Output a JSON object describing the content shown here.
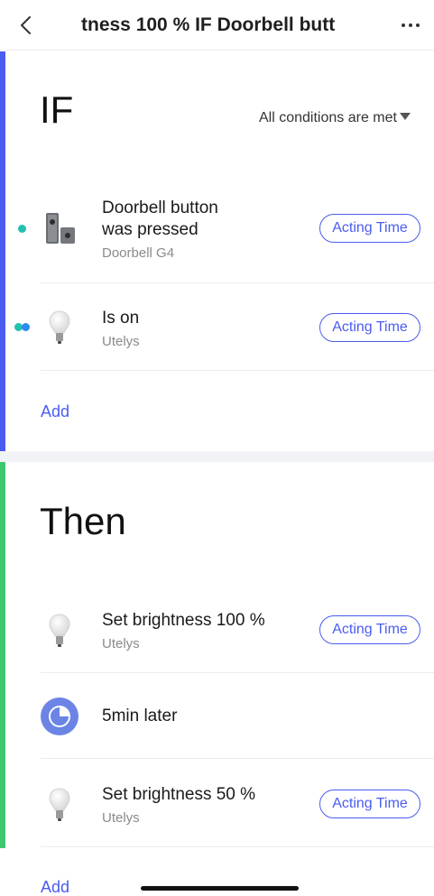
{
  "nav": {
    "title": "tness 100 %    IF Doorbell butt",
    "back_icon": "chevron-left-icon",
    "more_icon": "more-dots-icon"
  },
  "if_section": {
    "heading": "IF",
    "condition_mode": "All conditions are met",
    "items": [
      {
        "title_line1": "Doorbell button",
        "title_line2": "was pressed",
        "device": "Doorbell G4",
        "action": "Acting Time",
        "icon": "doorbell-icon"
      },
      {
        "title_line1": "Is on",
        "device": "Utelys",
        "action": "Acting Time",
        "icon": "bulb-icon"
      }
    ],
    "add_label": "Add"
  },
  "then_section": {
    "heading": "Then",
    "items": [
      {
        "title": "Set brightness 100 %",
        "device": "Utelys",
        "action": "Acting Time",
        "icon": "bulb-icon"
      },
      {
        "title": "5min later",
        "icon": "clock-icon"
      },
      {
        "title": "Set brightness 50 %",
        "device": "Utelys",
        "action": "Acting Time",
        "icon": "bulb-icon"
      }
    ],
    "add_label": "Add"
  },
  "colors": {
    "accent": "#4b5cf0",
    "if_bar": "#4b5cf0",
    "then_bar": "#3ec76f",
    "teal_dot": "#22c1b0",
    "blue_dot": "#2a8bf2",
    "clock_bg": "#6b84e6"
  }
}
